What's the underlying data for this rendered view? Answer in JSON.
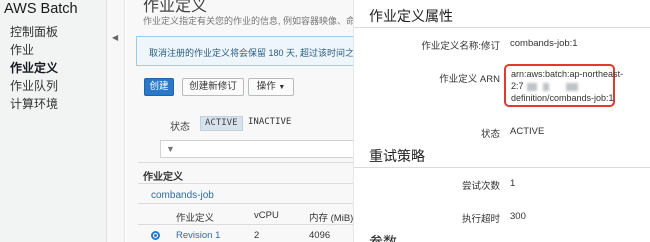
{
  "sidebar": {
    "brand": "AWS Batch",
    "items": [
      {
        "label": "控制面板"
      },
      {
        "label": "作业"
      },
      {
        "label": "作业定义"
      },
      {
        "label": "作业队列"
      },
      {
        "label": "计算环境"
      }
    ]
  },
  "main": {
    "title": "作业定义",
    "description": "作业定义指定有关您的作业的信息, 例如容器映像、命令、CF",
    "notice": "取消注册的作业定义将会保留 180 天, 超过该时间之后",
    "buttons": {
      "create": "创建",
      "create_revision": "创建新修订",
      "actions": "操作"
    },
    "filter": {
      "label": "状态",
      "options": [
        "ACTIVE",
        "INACTIVE"
      ],
      "selected": "ACTIVE",
      "search_icon": "filter-icon"
    },
    "table": {
      "section_title": "作业定义",
      "group": "combands-job",
      "columns": [
        "作业定义",
        "vCPU",
        "内存 (MiB)"
      ],
      "rows": [
        {
          "selected": true,
          "definition": "Revision 1",
          "vcpu": "2",
          "memory": "4096"
        }
      ]
    }
  },
  "panel": {
    "section1_title": "作业定义属性",
    "properties": {
      "name_label": "作业定义名称:修订",
      "name_value": "combands-job:1",
      "arn_label": "作业定义 ARN",
      "arn_line1": "arn:aws:batch:ap-northeast-",
      "arn_line2_prefix": "2:7",
      "arn_line3": "definition/combands-job:1",
      "status_label": "状态",
      "status_value": "ACTIVE"
    },
    "section2_title": "重试策略",
    "retry": {
      "attempts_label": "尝试次数",
      "attempts_value": "1",
      "timeout_label": "执行超时",
      "timeout_value": "300"
    },
    "section3_title": "参数"
  },
  "colors": {
    "primary_button": "#2a79c8",
    "highlight_box": "#e03a2f",
    "link": "#2e6da4"
  }
}
